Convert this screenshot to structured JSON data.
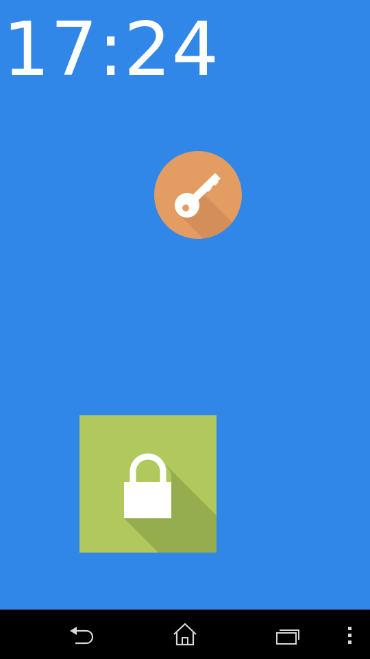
{
  "lockscreen": {
    "time": "17:24",
    "key_button": {
      "icon": "key-icon",
      "color": "#E39C62"
    },
    "lock_tile": {
      "icon": "padlock-icon",
      "color": "#B1C85D"
    },
    "background_color": "#3187E8"
  },
  "navbar": {
    "background_color": "#000000",
    "buttons": [
      {
        "icon": "back-icon"
      },
      {
        "icon": "home-icon"
      },
      {
        "icon": "recent-apps-icon"
      },
      {
        "icon": "overflow-menu-icon"
      }
    ]
  }
}
